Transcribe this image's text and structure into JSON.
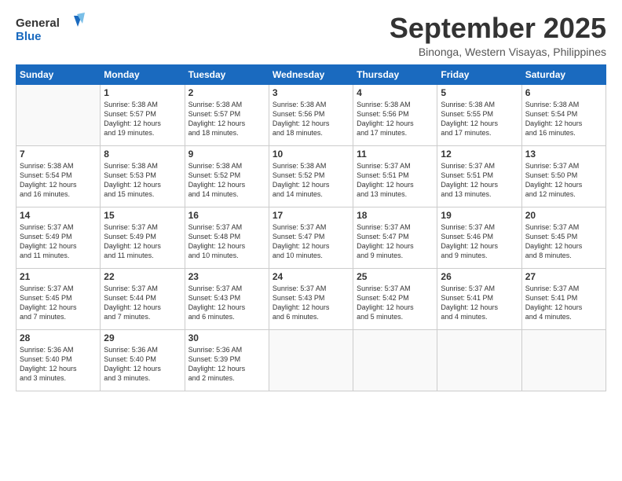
{
  "logo": {
    "line1": "General",
    "line2": "Blue"
  },
  "title": "September 2025",
  "subtitle": "Binonga, Western Visayas, Philippines",
  "weekdays": [
    "Sunday",
    "Monday",
    "Tuesday",
    "Wednesday",
    "Thursday",
    "Friday",
    "Saturday"
  ],
  "weeks": [
    [
      {
        "day": "",
        "info": ""
      },
      {
        "day": "1",
        "info": "Sunrise: 5:38 AM\nSunset: 5:57 PM\nDaylight: 12 hours\nand 19 minutes."
      },
      {
        "day": "2",
        "info": "Sunrise: 5:38 AM\nSunset: 5:57 PM\nDaylight: 12 hours\nand 18 minutes."
      },
      {
        "day": "3",
        "info": "Sunrise: 5:38 AM\nSunset: 5:56 PM\nDaylight: 12 hours\nand 18 minutes."
      },
      {
        "day": "4",
        "info": "Sunrise: 5:38 AM\nSunset: 5:56 PM\nDaylight: 12 hours\nand 17 minutes."
      },
      {
        "day": "5",
        "info": "Sunrise: 5:38 AM\nSunset: 5:55 PM\nDaylight: 12 hours\nand 17 minutes."
      },
      {
        "day": "6",
        "info": "Sunrise: 5:38 AM\nSunset: 5:54 PM\nDaylight: 12 hours\nand 16 minutes."
      }
    ],
    [
      {
        "day": "7",
        "info": "Sunrise: 5:38 AM\nSunset: 5:54 PM\nDaylight: 12 hours\nand 16 minutes."
      },
      {
        "day": "8",
        "info": "Sunrise: 5:38 AM\nSunset: 5:53 PM\nDaylight: 12 hours\nand 15 minutes."
      },
      {
        "day": "9",
        "info": "Sunrise: 5:38 AM\nSunset: 5:52 PM\nDaylight: 12 hours\nand 14 minutes."
      },
      {
        "day": "10",
        "info": "Sunrise: 5:38 AM\nSunset: 5:52 PM\nDaylight: 12 hours\nand 14 minutes."
      },
      {
        "day": "11",
        "info": "Sunrise: 5:37 AM\nSunset: 5:51 PM\nDaylight: 12 hours\nand 13 minutes."
      },
      {
        "day": "12",
        "info": "Sunrise: 5:37 AM\nSunset: 5:51 PM\nDaylight: 12 hours\nand 13 minutes."
      },
      {
        "day": "13",
        "info": "Sunrise: 5:37 AM\nSunset: 5:50 PM\nDaylight: 12 hours\nand 12 minutes."
      }
    ],
    [
      {
        "day": "14",
        "info": "Sunrise: 5:37 AM\nSunset: 5:49 PM\nDaylight: 12 hours\nand 11 minutes."
      },
      {
        "day": "15",
        "info": "Sunrise: 5:37 AM\nSunset: 5:49 PM\nDaylight: 12 hours\nand 11 minutes."
      },
      {
        "day": "16",
        "info": "Sunrise: 5:37 AM\nSunset: 5:48 PM\nDaylight: 12 hours\nand 10 minutes."
      },
      {
        "day": "17",
        "info": "Sunrise: 5:37 AM\nSunset: 5:47 PM\nDaylight: 12 hours\nand 10 minutes."
      },
      {
        "day": "18",
        "info": "Sunrise: 5:37 AM\nSunset: 5:47 PM\nDaylight: 12 hours\nand 9 minutes."
      },
      {
        "day": "19",
        "info": "Sunrise: 5:37 AM\nSunset: 5:46 PM\nDaylight: 12 hours\nand 9 minutes."
      },
      {
        "day": "20",
        "info": "Sunrise: 5:37 AM\nSunset: 5:45 PM\nDaylight: 12 hours\nand 8 minutes."
      }
    ],
    [
      {
        "day": "21",
        "info": "Sunrise: 5:37 AM\nSunset: 5:45 PM\nDaylight: 12 hours\nand 7 minutes."
      },
      {
        "day": "22",
        "info": "Sunrise: 5:37 AM\nSunset: 5:44 PM\nDaylight: 12 hours\nand 7 minutes."
      },
      {
        "day": "23",
        "info": "Sunrise: 5:37 AM\nSunset: 5:43 PM\nDaylight: 12 hours\nand 6 minutes."
      },
      {
        "day": "24",
        "info": "Sunrise: 5:37 AM\nSunset: 5:43 PM\nDaylight: 12 hours\nand 6 minutes."
      },
      {
        "day": "25",
        "info": "Sunrise: 5:37 AM\nSunset: 5:42 PM\nDaylight: 12 hours\nand 5 minutes."
      },
      {
        "day": "26",
        "info": "Sunrise: 5:37 AM\nSunset: 5:41 PM\nDaylight: 12 hours\nand 4 minutes."
      },
      {
        "day": "27",
        "info": "Sunrise: 5:37 AM\nSunset: 5:41 PM\nDaylight: 12 hours\nand 4 minutes."
      }
    ],
    [
      {
        "day": "28",
        "info": "Sunrise: 5:36 AM\nSunset: 5:40 PM\nDaylight: 12 hours\nand 3 minutes."
      },
      {
        "day": "29",
        "info": "Sunrise: 5:36 AM\nSunset: 5:40 PM\nDaylight: 12 hours\nand 3 minutes."
      },
      {
        "day": "30",
        "info": "Sunrise: 5:36 AM\nSunset: 5:39 PM\nDaylight: 12 hours\nand 2 minutes."
      },
      {
        "day": "",
        "info": ""
      },
      {
        "day": "",
        "info": ""
      },
      {
        "day": "",
        "info": ""
      },
      {
        "day": "",
        "info": ""
      }
    ]
  ]
}
